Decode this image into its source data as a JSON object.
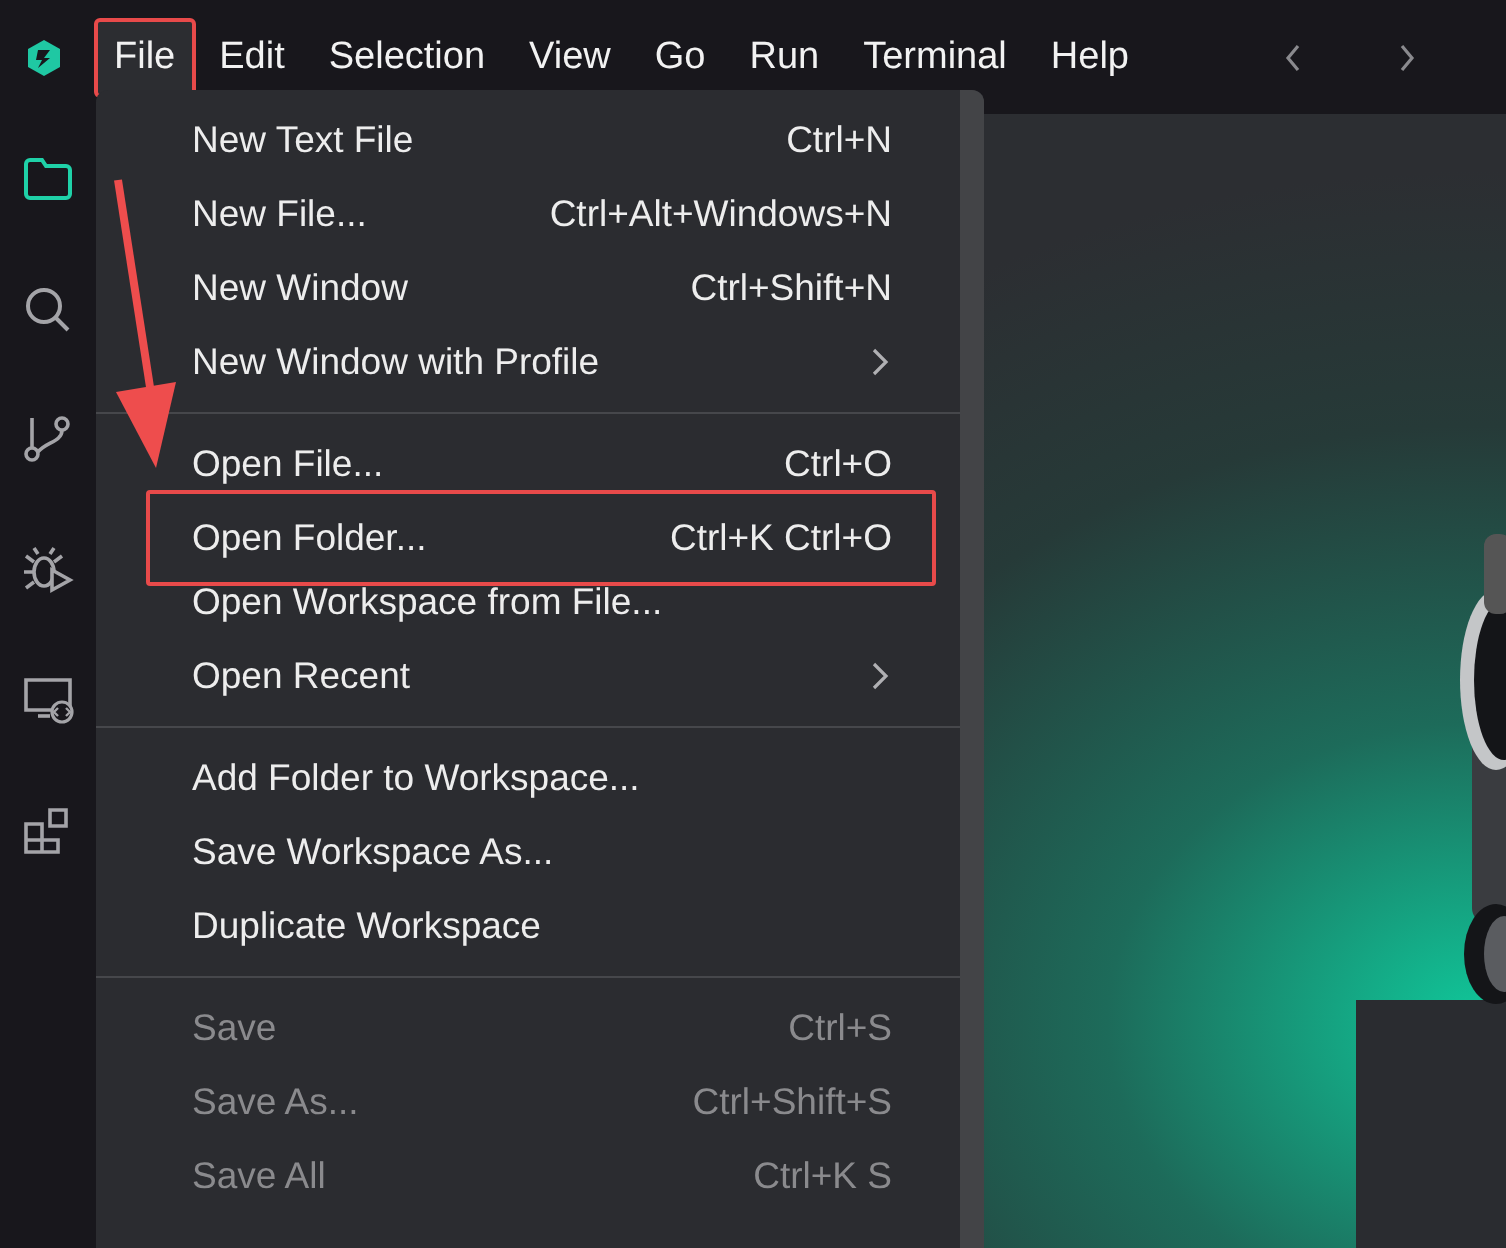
{
  "menubar": [
    {
      "label": "File",
      "annotated": true,
      "selected": true
    },
    {
      "label": "Edit",
      "annotated": false,
      "selected": false
    },
    {
      "label": "Selection",
      "annotated": false,
      "selected": false
    },
    {
      "label": "View",
      "annotated": false,
      "selected": false
    },
    {
      "label": "Go",
      "annotated": false,
      "selected": false
    },
    {
      "label": "Run",
      "annotated": false,
      "selected": false
    },
    {
      "label": "Terminal",
      "annotated": false,
      "selected": false
    },
    {
      "label": "Help",
      "annotated": false,
      "selected": false
    }
  ],
  "activity_bar": [
    {
      "kind": "explorer",
      "selected": true
    },
    {
      "kind": "search",
      "selected": false
    },
    {
      "kind": "source-control",
      "selected": false
    },
    {
      "kind": "debug",
      "selected": false
    },
    {
      "kind": "remote",
      "selected": false
    },
    {
      "kind": "extensions",
      "selected": false
    }
  ],
  "file_menu": {
    "groups": [
      [
        {
          "label": "New Text File",
          "shortcut": "Ctrl+N",
          "submenu": false,
          "disabled": false,
          "annotated": false
        },
        {
          "label": "New File...",
          "shortcut": "Ctrl+Alt+Windows+N",
          "submenu": false,
          "disabled": false,
          "annotated": false
        },
        {
          "label": "New Window",
          "shortcut": "Ctrl+Shift+N",
          "submenu": false,
          "disabled": false,
          "annotated": false
        },
        {
          "label": "New Window with Profile",
          "submenu": true,
          "disabled": false,
          "annotated": false
        }
      ],
      [
        {
          "label": "Open File...",
          "shortcut": "Ctrl+O",
          "submenu": false,
          "disabled": false,
          "annotated": false
        },
        {
          "label": "Open Folder...",
          "shortcut": "Ctrl+K Ctrl+O",
          "submenu": false,
          "disabled": false,
          "annotated": true
        },
        {
          "label": "Open Workspace from File...",
          "submenu": false,
          "disabled": false,
          "annotated": false
        },
        {
          "label": "Open Recent",
          "submenu": true,
          "disabled": false,
          "annotated": false
        }
      ],
      [
        {
          "label": "Add Folder to Workspace...",
          "submenu": false,
          "disabled": false,
          "annotated": false
        },
        {
          "label": "Save Workspace As...",
          "submenu": false,
          "disabled": false,
          "annotated": false
        },
        {
          "label": "Duplicate Workspace",
          "submenu": false,
          "disabled": false,
          "annotated": false
        }
      ],
      [
        {
          "label": "Save",
          "shortcut": "Ctrl+S",
          "submenu": false,
          "disabled": true,
          "annotated": false
        },
        {
          "label": "Save As...",
          "shortcut": "Ctrl+Shift+S",
          "submenu": false,
          "disabled": true,
          "annotated": false
        },
        {
          "label": "Save All",
          "shortcut": "Ctrl+K S",
          "submenu": false,
          "disabled": true,
          "annotated": false
        }
      ]
    ]
  }
}
